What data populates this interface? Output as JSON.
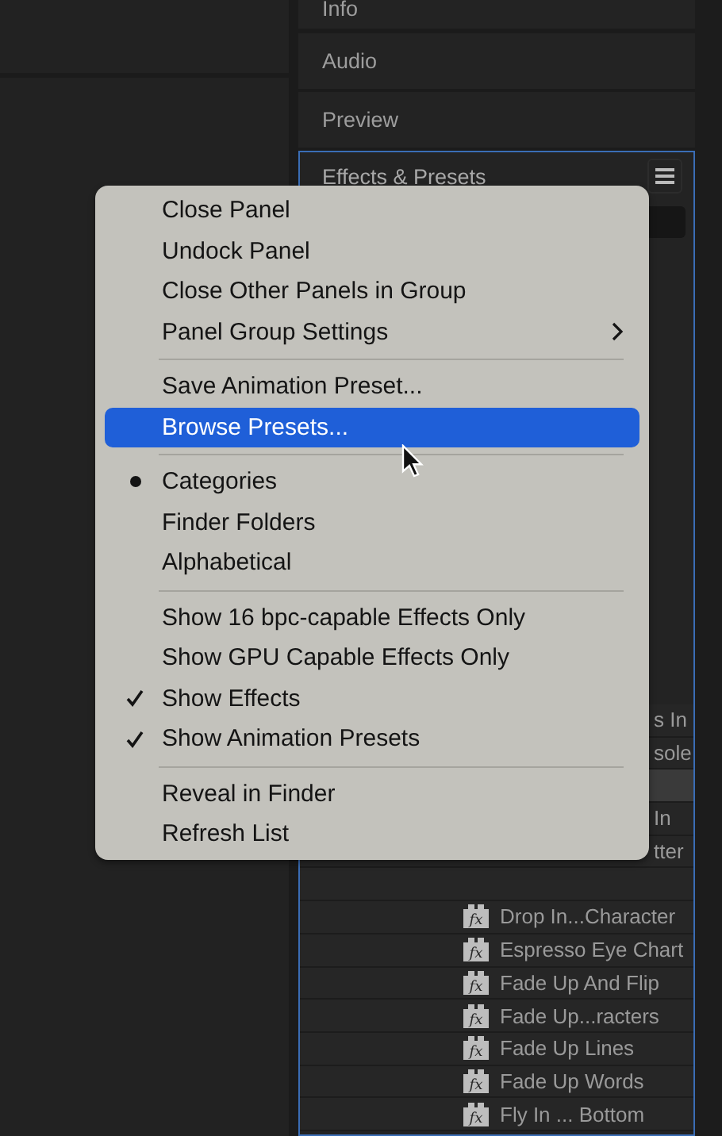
{
  "panels": [
    {
      "title": "Info"
    },
    {
      "title": "Audio"
    },
    {
      "title": "Preview"
    }
  ],
  "effects_panel": {
    "title": "Effects & Presets",
    "focused": true,
    "rows": [
      {
        "kind": "fragment",
        "text": "s In",
        "selected": false
      },
      {
        "kind": "fragment",
        "text": "sole",
        "selected": false
      },
      {
        "kind": "blank",
        "selected": true
      },
      {
        "kind": "fragment",
        "text": "In",
        "selected": false
      },
      {
        "kind": "fragment",
        "text": "tter",
        "selected": false
      },
      {
        "kind": "blank",
        "selected": false
      },
      {
        "kind": "effect",
        "icon": "fx",
        "text": "Drop In...Character",
        "selected": false
      },
      {
        "kind": "effect",
        "icon": "fx",
        "text": "Espresso Eye Chart",
        "selected": false
      },
      {
        "kind": "effect",
        "icon": "fx",
        "text": "Fade Up And Flip",
        "selected": false
      },
      {
        "kind": "effect",
        "icon": "fx",
        "text": "Fade Up...racters",
        "selected": false
      },
      {
        "kind": "effect",
        "icon": "fx",
        "text": "Fade Up Lines",
        "selected": false
      },
      {
        "kind": "effect",
        "icon": "fx",
        "text": "Fade Up Words",
        "selected": false
      },
      {
        "kind": "effect",
        "icon": "fx",
        "text": "Fly In ... Bottom",
        "selected": false
      }
    ]
  },
  "context_menu": {
    "items": [
      {
        "kind": "action",
        "label": "Close Panel",
        "highlighted": false
      },
      {
        "kind": "action",
        "label": "Undock Panel",
        "highlighted": false
      },
      {
        "kind": "action",
        "label": "Close Other Panels in Group",
        "highlighted": false
      },
      {
        "kind": "submenu",
        "label": "Panel Group Settings",
        "highlighted": false
      },
      {
        "kind": "separator"
      },
      {
        "kind": "action",
        "label": "Save Animation Preset...",
        "highlighted": false
      },
      {
        "kind": "action",
        "label": "Browse Presets...",
        "highlighted": true
      },
      {
        "kind": "separator"
      },
      {
        "kind": "radio",
        "label": "Categories",
        "selected": true,
        "highlighted": false
      },
      {
        "kind": "radio",
        "label": "Finder Folders",
        "selected": false,
        "highlighted": false
      },
      {
        "kind": "radio",
        "label": "Alphabetical",
        "selected": false,
        "highlighted": false
      },
      {
        "kind": "separator"
      },
      {
        "kind": "toggle",
        "label": "Show 16 bpc-capable Effects Only",
        "checked": false,
        "highlighted": false
      },
      {
        "kind": "toggle",
        "label": "Show GPU Capable Effects Only",
        "checked": false,
        "highlighted": false
      },
      {
        "kind": "toggle",
        "label": "Show Effects",
        "checked": true,
        "highlighted": false
      },
      {
        "kind": "toggle",
        "label": "Show Animation Presets",
        "checked": true,
        "highlighted": false
      },
      {
        "kind": "separator"
      },
      {
        "kind": "action",
        "label": "Reveal in Finder",
        "highlighted": false
      },
      {
        "kind": "action",
        "label": "Refresh List",
        "highlighted": false
      }
    ]
  }
}
